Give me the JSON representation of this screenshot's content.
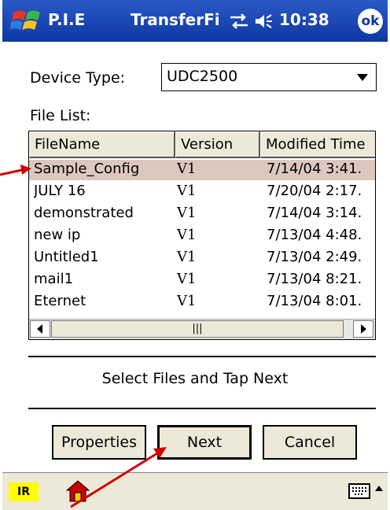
{
  "titlebar": {
    "app_name": "P.I.E",
    "window_title": "TransferFi",
    "clock": "10:38",
    "ok_label": "ok"
  },
  "device_type": {
    "label": "Device Type:",
    "value": "UDC2500"
  },
  "file_list": {
    "label": "File List:",
    "columns": [
      "FileName",
      "Version",
      "Modified Time"
    ],
    "rows": [
      {
        "name": "Sample_Config",
        "version": "V1",
        "modified": "7/14/04 3:41."
      },
      {
        "name": "JULY 16",
        "version": "V1",
        "modified": "7/20/04 2:17."
      },
      {
        "name": "demonstrated",
        "version": "V1",
        "modified": "7/14/04 3:14."
      },
      {
        "name": "new ip",
        "version": "V1",
        "modified": "7/13/04 4:48."
      },
      {
        "name": "Untitled1",
        "version": "V1",
        "modified": "7/13/04 2:49."
      },
      {
        "name": "mail1",
        "version": "V1",
        "modified": "7/13/04 8:21."
      },
      {
        "name": "Eternet",
        "version": "V1",
        "modified": "7/13/04 8:01."
      }
    ],
    "selected_row": 0
  },
  "instruction": "Select Files and Tap Next",
  "buttons": {
    "properties": "Properties",
    "next": "Next",
    "cancel": "Cancel"
  },
  "taskbar": {
    "ir_label": "IR"
  },
  "colors": {
    "titlebar": "#0e37a3",
    "selection": "#ddc8c0",
    "annotation_arrow": "#d00000"
  }
}
